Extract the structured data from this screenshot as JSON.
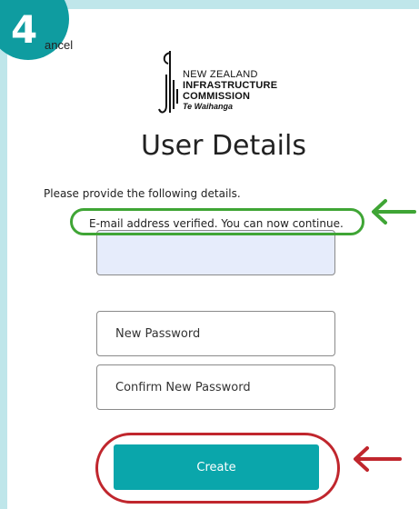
{
  "step": {
    "number": "4"
  },
  "header": {
    "cancel_label": "ancel"
  },
  "logo": {
    "line1": "NEW ZEALAND",
    "line2": "INFRASTRUCTURE",
    "line3": "COMMISSION",
    "line4": "Te Waihanga"
  },
  "page": {
    "title": "User Details",
    "intro": "Please provide the following details.",
    "verified_message": "E-mail address verified. You can now continue."
  },
  "form": {
    "email_value": "",
    "new_password_placeholder": "New Password",
    "confirm_password_placeholder": "Confirm New Password",
    "create_label": "Create"
  },
  "colors": {
    "badge": "#0f9ca0",
    "button": "#0aa6ab",
    "verified_highlight": "#3fa535",
    "create_highlight": "#c0262d",
    "backdrop": "#bfe6ea"
  },
  "icons": {
    "verified_pointer": "arrow-left-icon",
    "create_pointer": "arrow-left-icon"
  }
}
